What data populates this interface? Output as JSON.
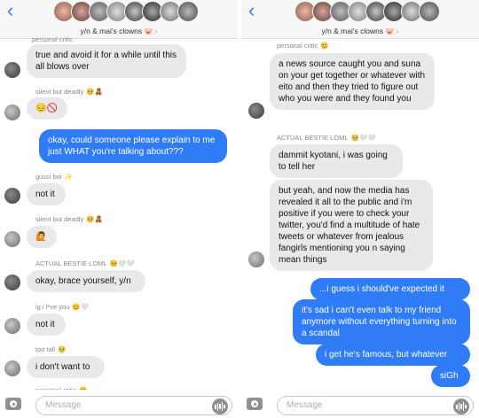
{
  "colors": {
    "outgoing": "#2f7cf6",
    "incoming": "#e9e9eb",
    "back": "#2f7cf6"
  },
  "left": {
    "header": {
      "back_icon": "‹",
      "title": "y/n & mai's clowns",
      "title_emoji": "🐷",
      "chevron": "›"
    },
    "messages": [
      {
        "sender": "personal critic",
        "text": ""
      },
      {
        "text": "true and avoid it for a while until this all blows over"
      },
      {
        "sender": "silent but deadly",
        "sender_emoji": "🥺🧸",
        "text": "😔🚫"
      },
      {
        "text": "okay, could someone please explain to me just WHAT you're talking about???"
      },
      {
        "sender": "gucci boi",
        "sender_emoji": "✨",
        "text": "not it"
      },
      {
        "sender": "silent but deadly",
        "sender_emoji": "🥺🧸",
        "text": "🙋"
      },
      {
        "sender": "ACTUAL BESTIE LOML",
        "sender_emoji": "🥺🤍🤍",
        "text": "okay, brace yourself, y/n"
      },
      {
        "sender": "ig i l*ve you",
        "sender_emoji": "😊🤍",
        "text": "not it"
      },
      {
        "sender": "too tall",
        "sender_emoji": "🥺",
        "text": "i don't want to"
      },
      {
        "sender": "personal critic",
        "sender_emoji": "😊",
        "text": ""
      }
    ],
    "input": {
      "placeholder": "Message"
    }
  },
  "right": {
    "header": {
      "back_icon": "‹",
      "title": "y/n & mai's clowns",
      "title_emoji": "🐷",
      "chevron": "›"
    },
    "messages": [
      {
        "sender": "personal critic",
        "sender_emoji": "😊",
        "text": "a news source caught you and suna on your get together or whatever with eito and then they tried to figure out who you were and they found you"
      },
      {
        "sender": "ACTUAL BESTIE LOML",
        "sender_emoji": "🥺🤍🤍",
        "text": "dammit kyotani, i was going to tell her"
      },
      {
        "text": "but yeah, and now the media has revealed it all to the public and i'm positive if you were to check your twitter, you'd find a multitude of hate tweets or whatever from jealous fangirls mentioning you n saying mean things"
      },
      {
        "text": "...i guess i should've expected it"
      },
      {
        "text": "it's sad i can't even talk to my friend anymore without everything turning into a scandal"
      },
      {
        "text": "i get he's famous, but whatever"
      },
      {
        "text": "siGh"
      }
    ],
    "input": {
      "placeholder": "Message"
    }
  }
}
